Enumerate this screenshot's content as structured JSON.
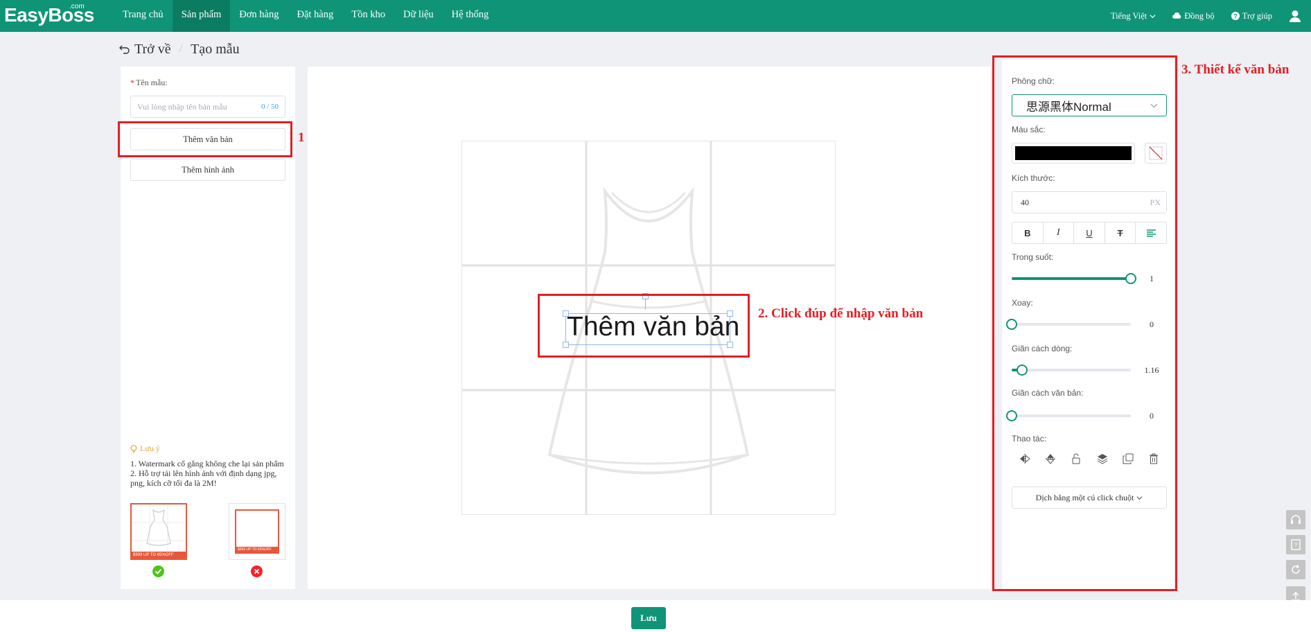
{
  "app": {
    "logo": "EasyBoss",
    "logo_suffix": ".com"
  },
  "nav": {
    "items": [
      {
        "label": "Trang chủ",
        "active": false
      },
      {
        "label": "Sản phẩm",
        "active": true
      },
      {
        "label": "Đơn hàng",
        "active": false
      },
      {
        "label": "Đặt hàng",
        "active": false
      },
      {
        "label": "Tồn kho",
        "active": false
      },
      {
        "label": "Dữ liệu",
        "active": false
      },
      {
        "label": "Hệ thống",
        "active": false
      }
    ]
  },
  "topright": {
    "language": "Tiếng Việt",
    "sync": "Đồng bộ",
    "help": "Trợ giúp"
  },
  "breadcrumb": {
    "back": "Trở về",
    "current": "Tạo mẫu"
  },
  "left": {
    "name_label": "Tên mẫu:",
    "name_placeholder": "Vui lòng nhập tên bản mẫu",
    "name_counter": "0 / 50",
    "add_text": "Thêm văn bản",
    "add_image": "Thêm hình ảnh",
    "note_title": "Lưu ý",
    "note_line1": "1. Watermark cố gắng không che lại sản phẩm",
    "note_line2": "2. Hỗ trợ tải lên hình ảnh với định dạng jpg, png, kích cỡ tối đa là 2M!",
    "badge_good": "$999 UP TO 65%OFF",
    "badge_bad": "$999 UP TO 65%OFF"
  },
  "canvas": {
    "text": "Thêm văn bản"
  },
  "annotations": {
    "step1": "1",
    "step2": "2. Click đúp để nhập văn bản",
    "step3": "3. Thiết kế văn bản"
  },
  "right": {
    "font_label": "Phông chữ:",
    "font_value": "思源黑体Normal",
    "color_label": "Màu sắc:",
    "color_value": "#000000",
    "size_label": "Kích thước:",
    "size_value": "40",
    "size_unit": "PX",
    "format_buttons": [
      "B",
      "I",
      "U",
      "T"
    ],
    "opacity_label": "Trong suốt:",
    "opacity_value": "1",
    "opacity_fraction": 1.0,
    "rotate_label": "Xoay:",
    "rotate_value": "0",
    "rotate_fraction": 0.0,
    "line_spacing_label": "Giãn cách dòng:",
    "line_spacing_value": "1.16",
    "line_spacing_fraction": 0.09,
    "letter_spacing_label": "Giãn cách văn bản:",
    "letter_spacing_value": "0",
    "letter_spacing_fraction": 0.0,
    "ops_label": "Thao tác:",
    "translate_button": "Dịch bằng một cú click chuột"
  },
  "footer": {
    "save": "Lưu"
  },
  "colors": {
    "brand": "#0f9477",
    "annotation": "#e31e24",
    "accent": "#e8573a"
  }
}
